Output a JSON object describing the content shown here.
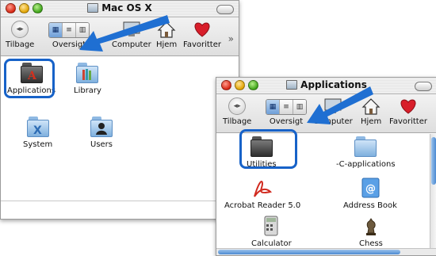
{
  "window1": {
    "title": "Mac OS X",
    "toolbar": {
      "back_label": "Tilbage",
      "view_label": "Oversigt",
      "computer_label": "Computer",
      "home_label": "Hjem",
      "favorites_label": "Favoritter",
      "more_glyph": "»"
    },
    "items": [
      {
        "label": "Applications",
        "icon": "applications-folder-icon"
      },
      {
        "label": "Library",
        "icon": "library-folder-icon"
      },
      {
        "label": "System",
        "icon": "system-folder-icon"
      },
      {
        "label": "Users",
        "icon": "users-folder-icon"
      }
    ]
  },
  "window2": {
    "title": "Applications",
    "toolbar": {
      "back_label": "Tilbage",
      "view_label": "Oversigt",
      "computer_label": "Computer",
      "home_label": "Hjem",
      "favorites_label": "Favoritter",
      "more_glyph": "»"
    },
    "items": [
      {
        "label": "Utilities",
        "icon": "utilities-folder-icon"
      },
      {
        "label": "-C-applications",
        "icon": "folder-icon"
      },
      {
        "label": "Acrobat Reader 5.0",
        "icon": "acrobat-icon"
      },
      {
        "label": "Address Book",
        "icon": "address-book-icon"
      },
      {
        "label": "Calculator",
        "icon": "calculator-icon"
      },
      {
        "label": "Chess",
        "icon": "chess-icon"
      }
    ]
  },
  "colors": {
    "highlight": "#1762c8",
    "arrow": "#1f6fd2",
    "heart": "#d81e2a"
  }
}
